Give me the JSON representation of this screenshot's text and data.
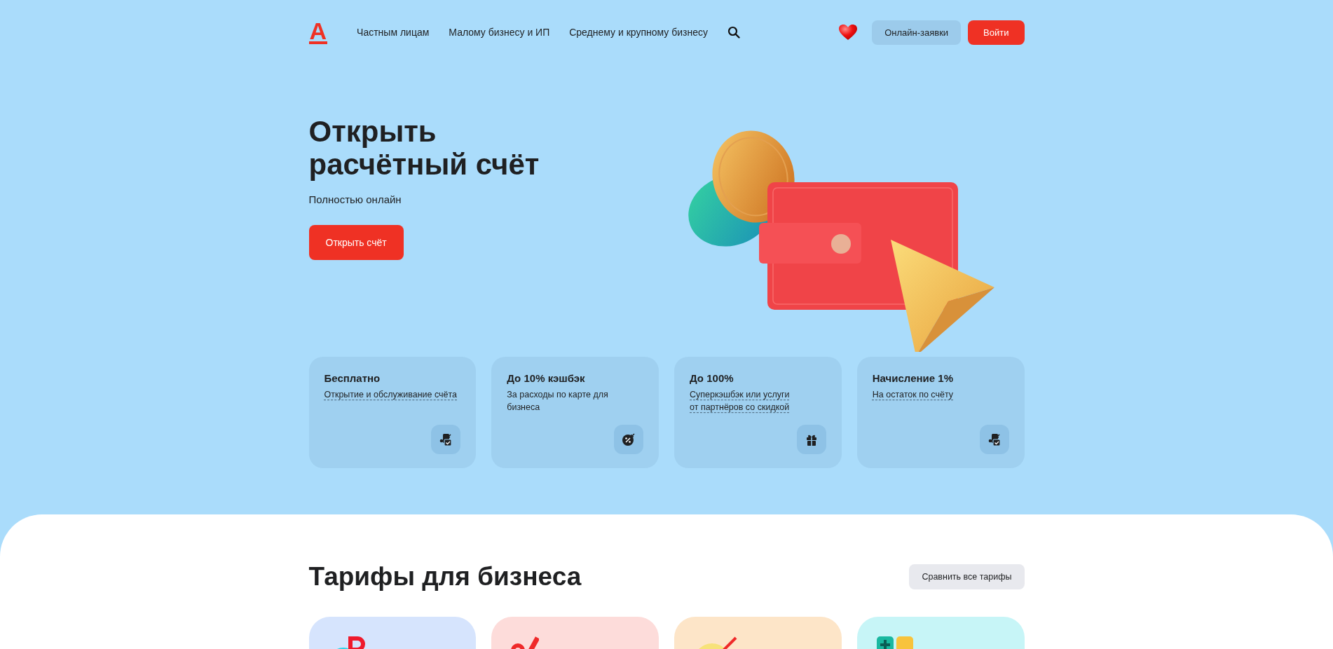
{
  "header": {
    "logo": "А",
    "nav": [
      {
        "label": "Частным лицам"
      },
      {
        "label": "Малому бизнесу и ИП"
      },
      {
        "label": "Среднему и крупному бизнесу"
      }
    ],
    "buttons": [
      {
        "label": "Онлайн-заявки",
        "kind": "secondary"
      },
      {
        "label": "Войти",
        "kind": "primary"
      }
    ]
  },
  "hero": {
    "title": "Открыть\nрасчётный счёт",
    "subtitle": "Полностью онлайн",
    "button": "Открыть счёт"
  },
  "features": [
    {
      "title": "Бесплатно",
      "text": "Открытие и обслуживание счёта",
      "underlined": true,
      "kind": "document"
    },
    {
      "title": "До 10% кэшбэк",
      "text": "За расходы по карте для бизнеса",
      "underlined": false,
      "kind": "percent"
    },
    {
      "title": "До 100%",
      "text": "Суперкэшбэк или услуги\nот партнёров со скидкой",
      "underlined": true,
      "kind": "gift"
    },
    {
      "title": "Начисление 1%",
      "text": "На остаток по счёту",
      "underlined": true,
      "kind": "document"
    }
  ],
  "tariffs": {
    "title": "Тарифы для бизнеса",
    "button": "Сравнить все тарифы",
    "cards": [
      {
        "color": "#d6e4fd",
        "kind": "letters"
      },
      {
        "color": "#fddcda",
        "kind": "percent"
      },
      {
        "color": "#fde5c8",
        "kind": "speed"
      },
      {
        "color": "#c7f5f7",
        "kind": "blocks"
      }
    ]
  }
}
